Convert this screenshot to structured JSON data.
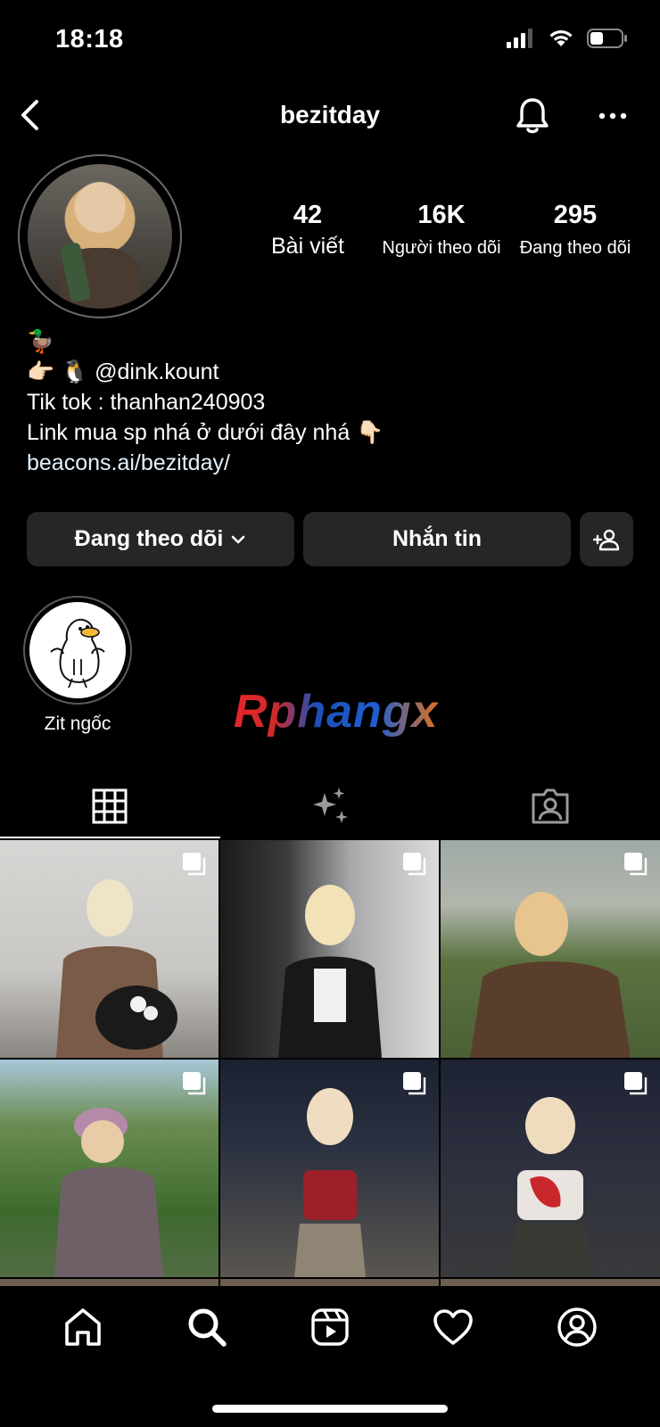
{
  "status_bar": {
    "time": "18:18",
    "icons": [
      "signal-icon",
      "wifi-icon",
      "battery-icon"
    ]
  },
  "header": {
    "username": "bezitday",
    "icons": [
      "back-icon",
      "bell-icon",
      "more-icon"
    ]
  },
  "stats": [
    {
      "value": "42",
      "label": "Bài viết"
    },
    {
      "value": "16K",
      "label": "Người theo dõi"
    },
    {
      "value": "295",
      "label": "Đang theo dõi"
    }
  ],
  "bio": {
    "line1": "🦆",
    "line2": "👉🏻 🐧 @dink.kount",
    "line3": "Tik tok : thanhan240903",
    "line4": "Link mua sp nhá ở dưới đây nhá 👇🏻",
    "link": "beacons.ai/bezitday/"
  },
  "buttons": {
    "following": "Đang theo dõi",
    "message": "Nhắn tin"
  },
  "highlight": {
    "label": "Zit ngốc"
  },
  "watermark": "Rphangx",
  "tabs": [
    "grid-icon",
    "reels-sparkle-icon",
    "tagged-icon"
  ],
  "nav": [
    "home-icon",
    "search-icon",
    "reels-icon",
    "heart-icon",
    "profile-icon"
  ],
  "colors": {
    "background": "#000000",
    "button_bg": "#262626",
    "text": "#ffffff"
  }
}
